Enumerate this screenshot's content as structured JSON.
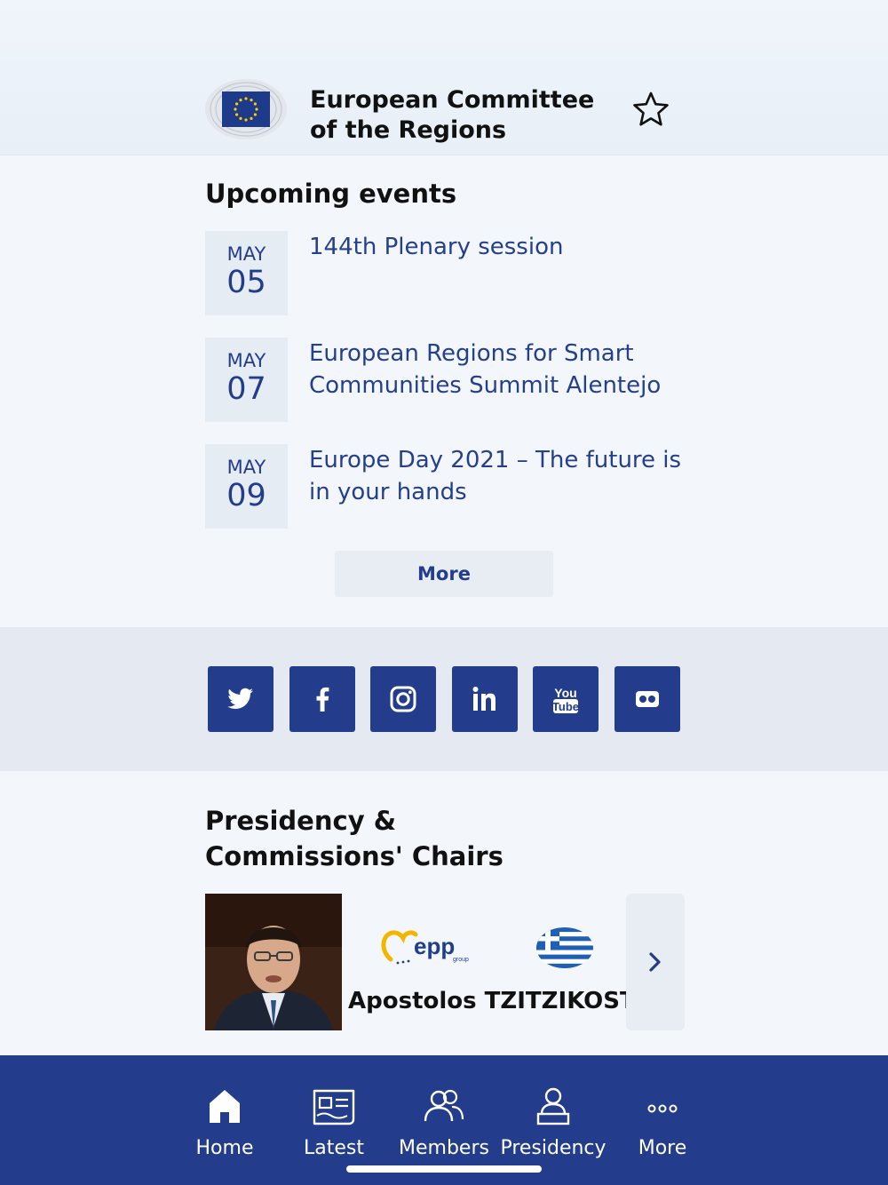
{
  "header": {
    "org_name": "European Committee of the Regions",
    "favorite_icon": "star-outline-icon"
  },
  "events": {
    "title": "Upcoming events",
    "items": [
      {
        "month": "MAY",
        "day": "05",
        "title": "144th Plenary session"
      },
      {
        "month": "MAY",
        "day": "07",
        "title": "European Regions for Smart Communities Summit Alentejo"
      },
      {
        "month": "MAY",
        "day": "09",
        "title": "Europe Day 2021 – The future is in your hands"
      }
    ],
    "more_label": "More"
  },
  "social": {
    "icons": [
      "twitter-icon",
      "facebook-icon",
      "instagram-icon",
      "linkedin-icon",
      "youtube-icon",
      "flickr-icon"
    ],
    "youtube_text_top": "You",
    "youtube_text_bottom": "Tube"
  },
  "presidency": {
    "title": "Presidency & Commissions' Chairs",
    "name": "Apostolos TZITZIKOSTAS",
    "party_logo_text": "epp",
    "party_logo_subtext": "group",
    "country_icon": "greece-flag-icon"
  },
  "tabbar": {
    "tabs": [
      {
        "label": "Home",
        "icon": "home-icon"
      },
      {
        "label": "Latest",
        "icon": "news-icon"
      },
      {
        "label": "Members",
        "icon": "members-icon"
      },
      {
        "label": "Presidency",
        "icon": "presidency-icon"
      },
      {
        "label": "More",
        "icon": "more-dots-icon"
      }
    ]
  },
  "colors": {
    "brand_blue": "#233d8c",
    "link_blue": "#253f8f",
    "eu_star_yellow": "#ffcc00"
  }
}
